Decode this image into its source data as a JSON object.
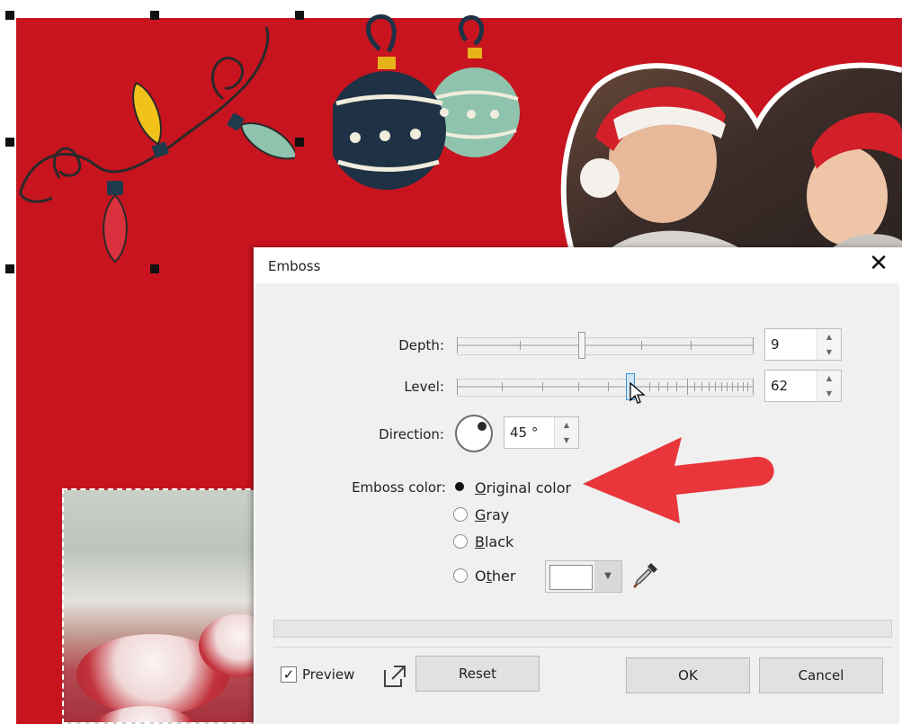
{
  "dialog": {
    "title": "Emboss",
    "close_glyph": "✕",
    "depth": {
      "label": "Depth:",
      "value": "9",
      "level_fraction": 0.42
    },
    "level": {
      "label": "Level:",
      "value": "62",
      "level_fraction": 0.59
    },
    "direction": {
      "label": "Direction:",
      "value": "45 °"
    },
    "emboss_color": {
      "label": "Emboss color:",
      "options": [
        {
          "label": "Original color",
          "accel": "O",
          "selected": true
        },
        {
          "label": "Gray",
          "accel": "G",
          "selected": false
        },
        {
          "label": "Black",
          "accel": "B",
          "selected": false
        },
        {
          "label": "Other",
          "accel": "t",
          "selected": false
        }
      ],
      "other_swatch_color": "#ffffff"
    },
    "preview": {
      "label": "Preview",
      "checked": true,
      "check_glyph": "✓"
    },
    "buttons": {
      "reset": "Reset",
      "ok": "OK",
      "cancel": "Cancel"
    }
  },
  "colors": {
    "card_red": "#c8141f",
    "annotation_arrow": "#e8363a",
    "slider_thumb_active": "#3c93d6"
  },
  "icons": {
    "dial": "direction-dial-icon",
    "eyedropper": "eyedropper-icon",
    "popout": "popout-icon",
    "spin_up": "▲",
    "spin_down": "▼",
    "dropdown": "▼"
  }
}
